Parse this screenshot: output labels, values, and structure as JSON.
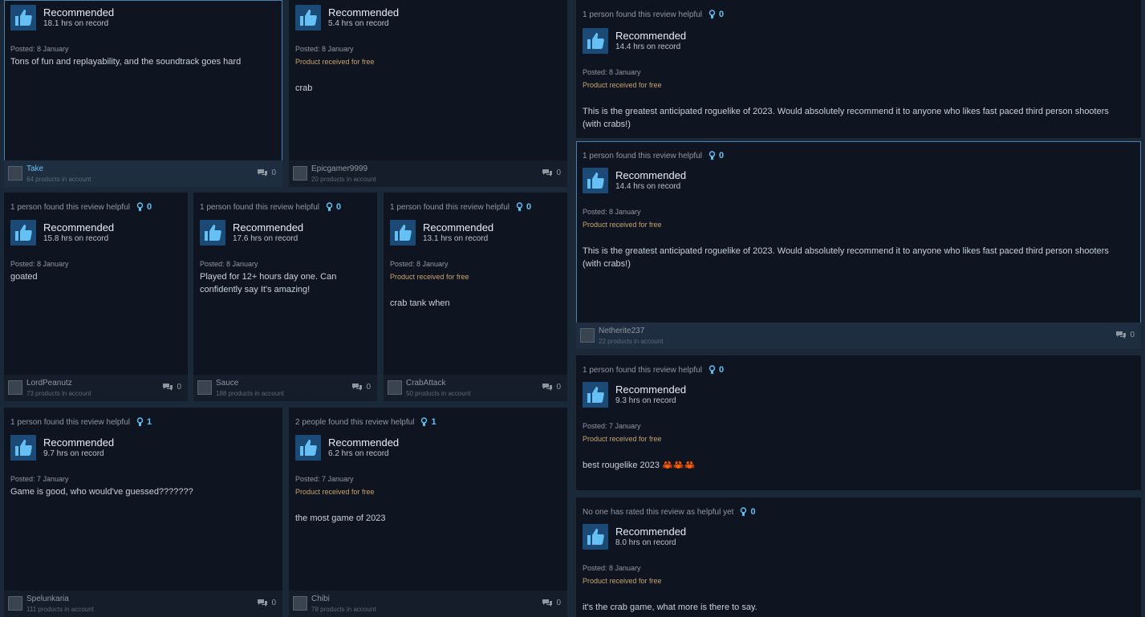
{
  "reviews": [
    {
      "helpful": "",
      "award": "",
      "recommendation": "Recommended",
      "hours": "18.1 hrs on record",
      "posted": "Posted: 8 January",
      "free": "",
      "text": "Tons of fun and replayability, and the soundtrack goes hard",
      "user": "Take",
      "products": "64 products in account",
      "comments": "0"
    },
    {
      "helpful": "",
      "award": "",
      "recommendation": "Recommended",
      "hours": "5.4 hrs on record",
      "posted": "Posted: 8 January",
      "free": "Product received for free",
      "text": "crab",
      "user": "Epicgamer9999",
      "products": "20 products in account",
      "comments": "0"
    },
    {
      "helpful": "1 person found this review helpful",
      "award": "0",
      "recommendation": "Recommended",
      "hours": "14.4 hrs on record",
      "posted": "Posted: 8 January",
      "free": "Product received for free",
      "text": "This is the greatest anticipated roguelike of 2023. Would absolutely recommend it to anyone who likes fast paced third person shooters (with crabs!)",
      "user": "",
      "products": "",
      "comments": ""
    },
    {
      "helpful": "1 person found this review helpful",
      "award": "0",
      "recommendation": "Recommended",
      "hours": "14.4 hrs on record",
      "posted": "Posted: 8 January",
      "free": "Product received for free",
      "text": "This is the greatest anticipated roguelike of 2023. Would absolutely recommend it to anyone who likes fast paced third person shooters (with crabs!)",
      "user": "Netherite237",
      "products": "22 products in account",
      "comments": "0"
    },
    {
      "helpful": "1 person found this review helpful",
      "award": "0",
      "recommendation": "Recommended",
      "hours": "15.8 hrs on record",
      "posted": "Posted: 8 January",
      "free": "",
      "text": "goated",
      "user": "LordPeanutz",
      "products": "73 products in account",
      "comments": "0"
    },
    {
      "helpful": "1 person found this review helpful",
      "award": "0",
      "recommendation": "Recommended",
      "hours": "17.6 hrs on record",
      "posted": "Posted: 8 January",
      "free": "",
      "text": "Played for 12+ hours day one. Can confidently say It's amazing!",
      "user": "Sauce",
      "products": "188 products in account",
      "comments": "0"
    },
    {
      "helpful": "1 person found this review helpful",
      "award": "0",
      "recommendation": "Recommended",
      "hours": "13.1 hrs on record",
      "posted": "Posted: 8 January",
      "free": "Product received for free",
      "text": "crab tank when",
      "user": "CrabAttack",
      "products": "50 products in account",
      "comments": "0"
    },
    {
      "helpful": "1 person found this review helpful",
      "award": "0",
      "recommendation": "Recommended",
      "hours": "9.3 hrs on record",
      "posted": "Posted: 7 January",
      "free": "Product received for free",
      "text": "best rougelike 2023 🦀🦀🦀",
      "user": "",
      "products": "",
      "comments": ""
    },
    {
      "helpful": "1 person found this review helpful",
      "award": "1",
      "recommendation": "Recommended",
      "hours": "9.7 hrs on record",
      "posted": "Posted: 7 January",
      "free": "",
      "text": "Game is good, who would've guessed???????",
      "user": "Spelunkaria",
      "products": "111 products in account",
      "comments": "0"
    },
    {
      "helpful": "2 people found this review helpful",
      "award": "1",
      "recommendation": "Recommended",
      "hours": "6.2 hrs on record",
      "posted": "Posted: 7 January",
      "free": "Product received for free",
      "text": "the most game of 2023",
      "user": "Chibi",
      "products": "78 products in account",
      "comments": "0"
    },
    {
      "helpful": "No one has rated this review as helpful yet",
      "award": "0",
      "recommendation": "Recommended",
      "hours": "8.0 hrs on record",
      "posted": "Posted: 8 January",
      "free": "Product received for free",
      "text": "it's the crab game, what more is there to say.",
      "user": "",
      "products": "",
      "comments": ""
    }
  ],
  "colors": {
    "accent": "#66c0f4",
    "free_text": "#c9a36e",
    "card_bg": "#0e1520",
    "page_bg": "#1b2838"
  }
}
